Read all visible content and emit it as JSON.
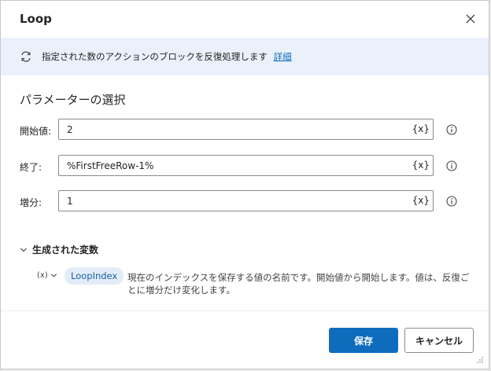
{
  "dialog": {
    "title": "Loop",
    "close_icon": "close-icon"
  },
  "info_bar": {
    "icon": "loop-icon",
    "text": "指定された数のアクションのブロックを反復処理します",
    "link": "詳細"
  },
  "parameters": {
    "section_title": "パラメーターの選択",
    "start": {
      "label": "開始値:",
      "value": "2",
      "var_button": "{x}"
    },
    "end": {
      "label": "終了:",
      "value": "%FirstFreeRow-1%",
      "var_button": "{x}"
    },
    "step": {
      "label": "増分:",
      "value": "1",
      "var_button": "{x}"
    }
  },
  "generated_variables": {
    "toggle_label": "生成された変数",
    "var_icon": "(x)",
    "variable_name": "LoopIndex",
    "description": "現在のインデックスを保存する値の名前です。開始値から開始します。値は、反復ごとに増分だけ変化します。"
  },
  "footer": {
    "save_label": "保存",
    "cancel_label": "キャンセル"
  },
  "colors": {
    "primary": "#0f6cbd",
    "info_bar_bg": "#eaf1fb",
    "pill_bg": "#e3edf8"
  }
}
